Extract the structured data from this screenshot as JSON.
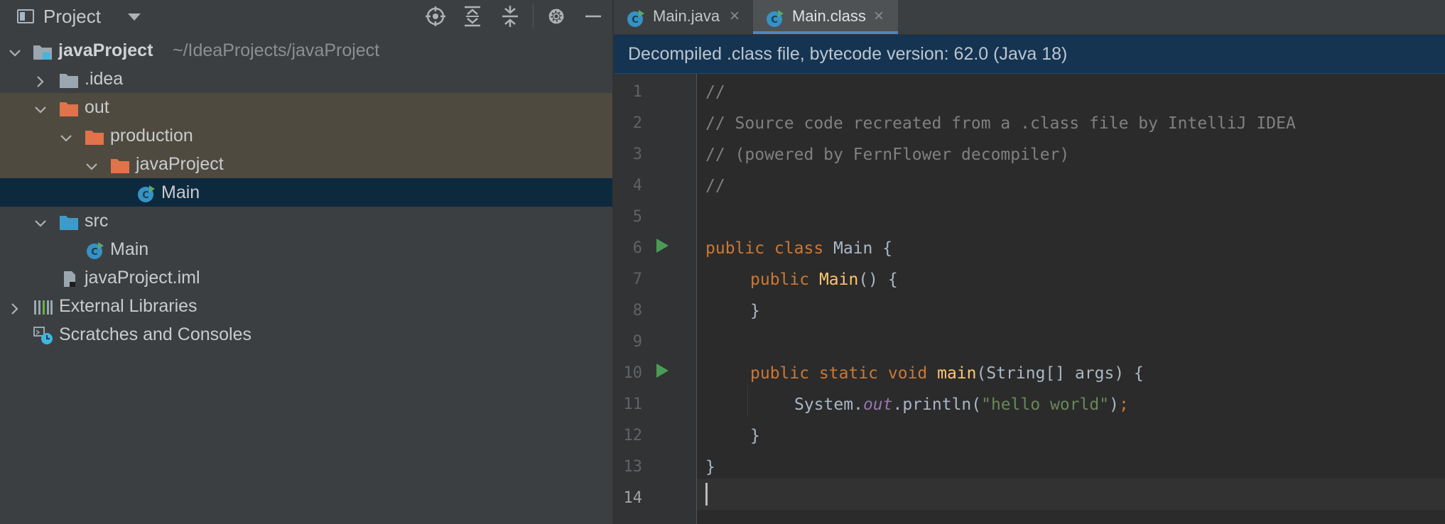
{
  "project_panel": {
    "title": "Project",
    "toolbar_icons": [
      "locate-icon",
      "expand-all-icon",
      "collapse-all-icon",
      "gear-icon",
      "minimize-icon"
    ],
    "tree": [
      {
        "label": "javaProject",
        "path": "~/IdeaProjects/javaProject",
        "icon": "module-folder-icon",
        "expanded": true
      },
      {
        "label": ".idea",
        "icon": "folder-icon",
        "expanded": false
      },
      {
        "label": "out",
        "icon": "excluded-folder-icon",
        "expanded": true
      },
      {
        "label": "production",
        "icon": "excluded-folder-icon",
        "expanded": true
      },
      {
        "label": "javaProject",
        "icon": "excluded-folder-icon",
        "expanded": true
      },
      {
        "label": "Main",
        "icon": "java-class-icon",
        "selected": true
      },
      {
        "label": "src",
        "icon": "source-folder-icon",
        "expanded": true
      },
      {
        "label": "Main",
        "icon": "java-class-icon"
      },
      {
        "label": "javaProject.iml",
        "icon": "iml-file-icon"
      },
      {
        "label": "External Libraries",
        "icon": "libraries-icon",
        "expanded": false
      },
      {
        "label": "Scratches and Consoles",
        "icon": "scratches-icon"
      }
    ]
  },
  "editor": {
    "tabs": [
      {
        "label": "Main.java",
        "close": "×",
        "active": false
      },
      {
        "label": "Main.class",
        "close": "×",
        "active": true
      }
    ],
    "notice": "Decompiled .class file, bytecode version: 62.0 (Java 18)",
    "line_numbers": [
      "1",
      "2",
      "3",
      "4",
      "5",
      "6",
      "7",
      "8",
      "9",
      "10",
      "11",
      "12",
      "13",
      "14"
    ],
    "current_line": "14",
    "code": {
      "l1": "//",
      "l2": "// Source code recreated from a .class file by IntelliJ IDEA",
      "l3": "// (powered by FernFlower decompiler)",
      "l4": "//",
      "l6_kw": "public class ",
      "l6_rest": "Main {",
      "l7_kw": "public ",
      "l7_fn": "Main",
      "l7_rest": "() {",
      "l8": "}",
      "l10_kw": "public static void ",
      "l10_fn": "main",
      "l10_rest": "(String[] args) {",
      "l11_a": "System.",
      "l11_field": "out",
      "l11_b": ".println(",
      "l11_str": "\"hello world\"",
      "l11_c": ")",
      "l11_semi": ";",
      "l12": "}",
      "l13": "}"
    }
  },
  "colors": {
    "panel_bg": "#3c3f41",
    "editor_bg": "#2b2b2b",
    "selection": "#0d293e",
    "excluded_highlight": "#4e4a3f",
    "notice_bg": "#153452",
    "keyword": "#cc7832",
    "function": "#ffc66d",
    "string": "#6a8759",
    "comment": "#808080",
    "static_field": "#9876aa",
    "tab_underline": "#4a88c7"
  }
}
